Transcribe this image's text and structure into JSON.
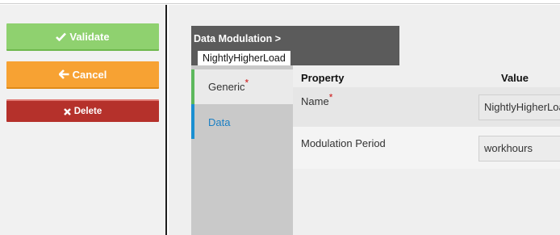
{
  "actions": {
    "validate_label": "Validate",
    "cancel_label": "Cancel",
    "delete_label": "Delete"
  },
  "header": {
    "title": "Data Modulation >",
    "entity_name": "NightlyHigherLoad"
  },
  "tabs": [
    {
      "label": "Generic",
      "required": true,
      "active": true
    },
    {
      "label": "Data",
      "required": false,
      "active": false
    }
  ],
  "table": {
    "columns": [
      "Property",
      "Value"
    ],
    "rows": [
      {
        "property": "Name",
        "required": true,
        "value": "NightlyHigherLoad"
      },
      {
        "property": "Modulation Period",
        "required": false,
        "value": "workhours"
      }
    ]
  },
  "colors": {
    "validate": "#8fd16f",
    "cancel": "#f7a233",
    "delete": "#b5312b",
    "generic_tab_accent": "#5cb85c",
    "data_tab_accent": "#1a8fd1",
    "header_bg": "#5b5b5b"
  },
  "icons": {
    "validate": "check-icon",
    "cancel": "arrow-left-icon",
    "delete": "close-icon"
  }
}
